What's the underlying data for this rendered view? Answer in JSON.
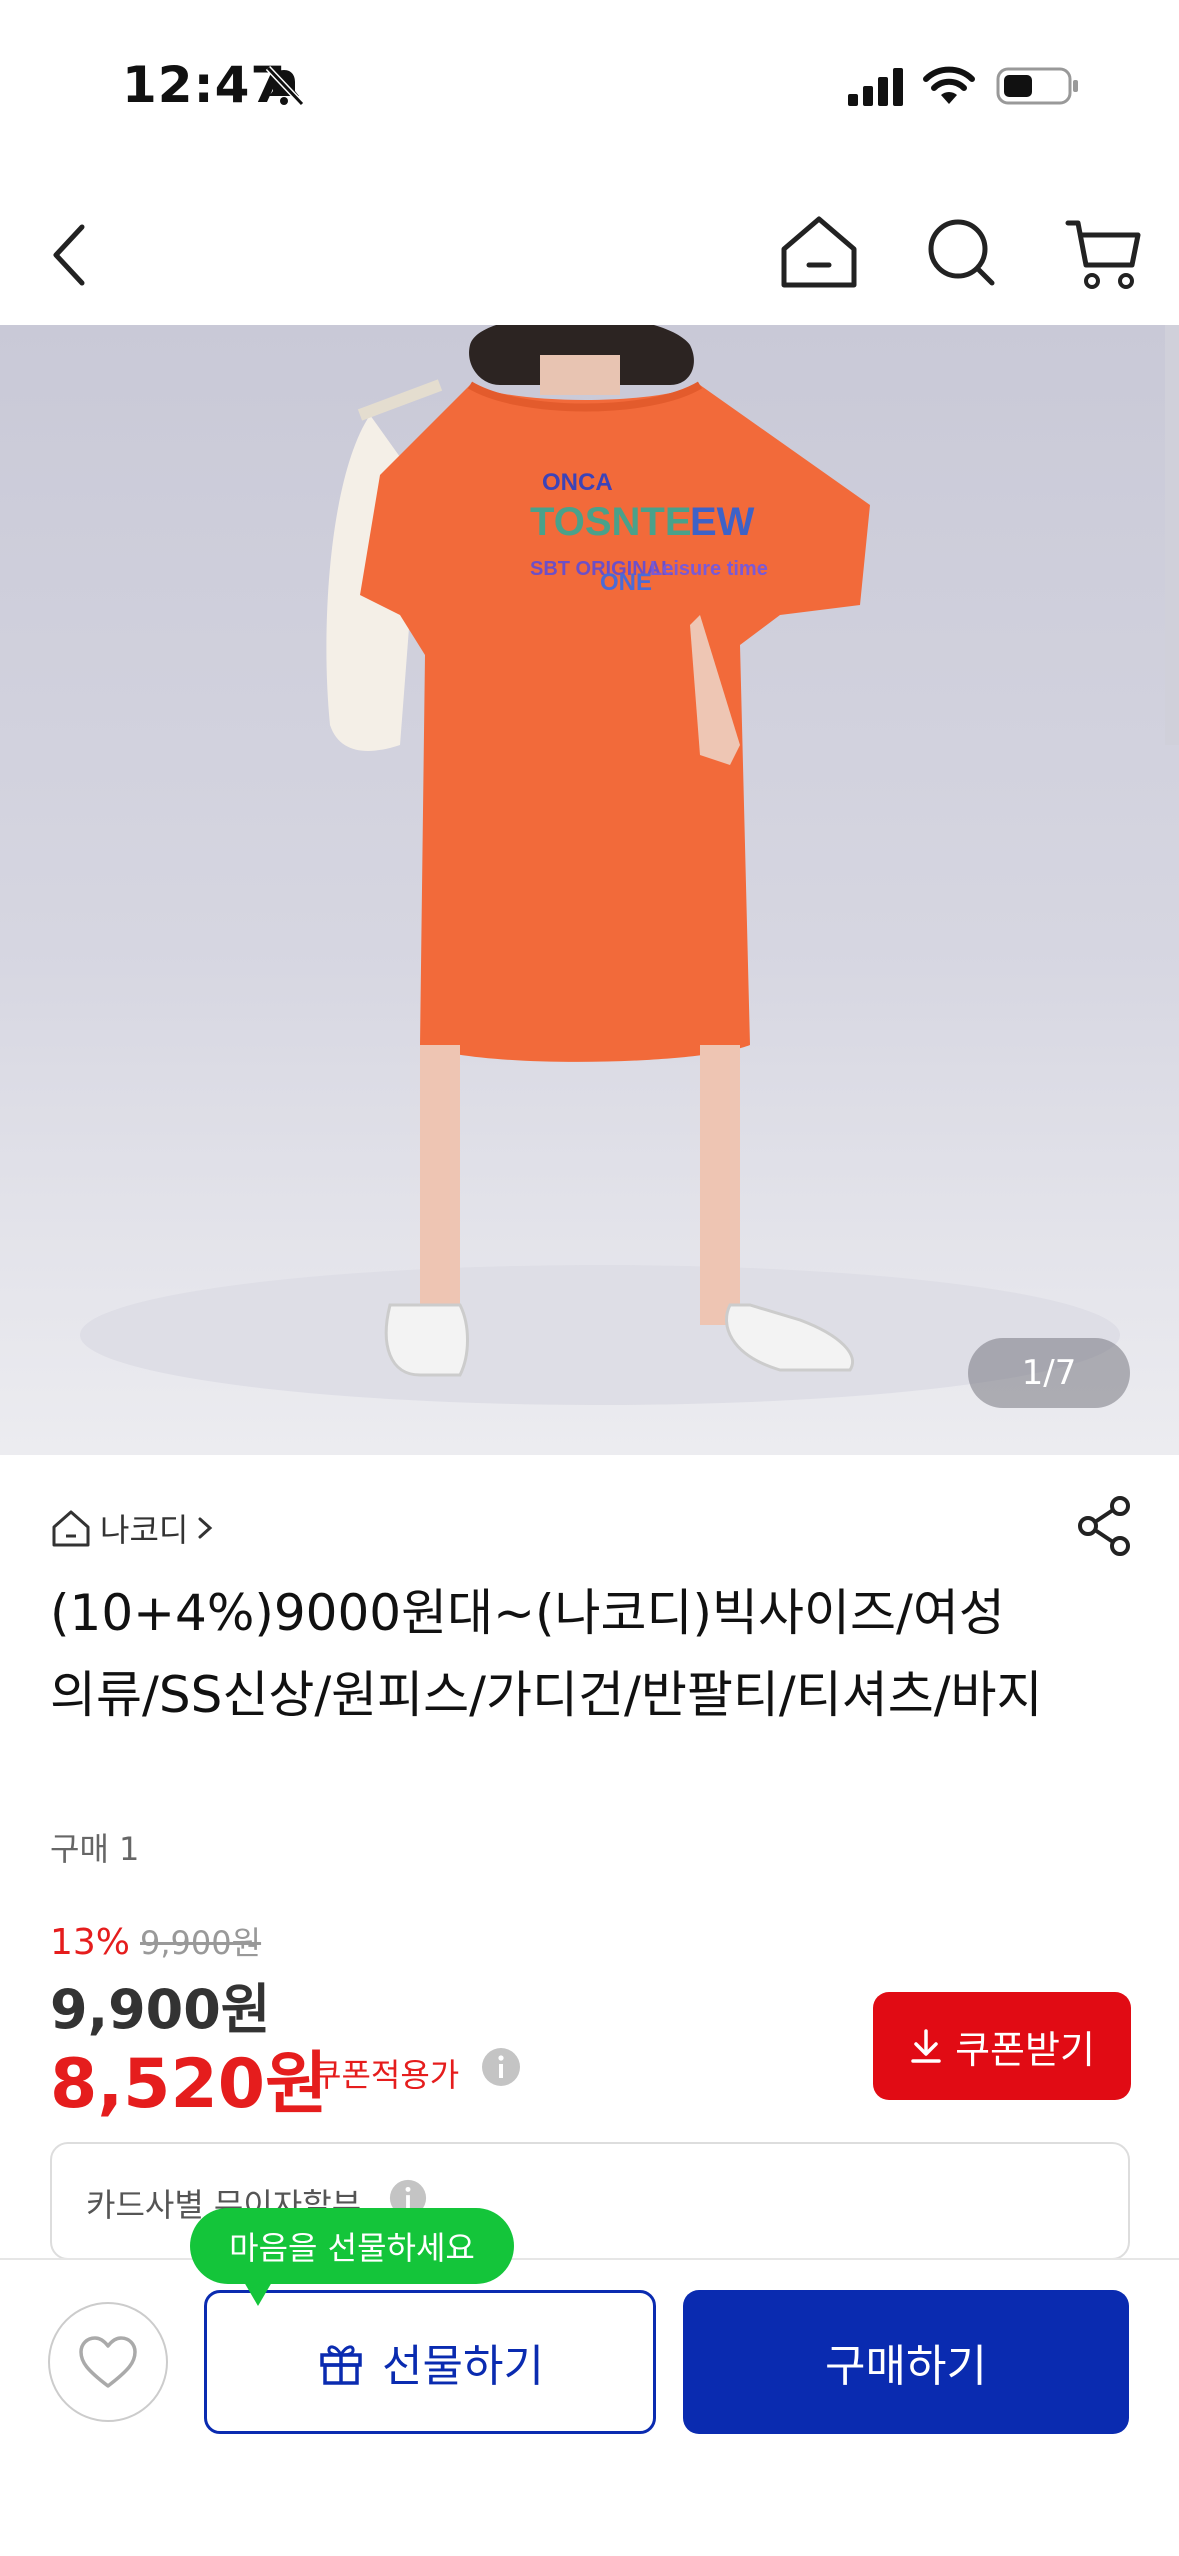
{
  "status_bar": {
    "time": "12:47"
  },
  "product": {
    "image_counter": "1/7",
    "seller_name": "나코디",
    "title": "(10+4%)9000원대~(나코디)빅사이즈/여성의류/SS신상/원피스/가디건/반팔티/티셔츠/바지",
    "purchase_count": "구매 1",
    "discount_rate": "13%",
    "original_price": "9,900원",
    "sale_price": "9,900원",
    "coupon_price": "8,520원",
    "coupon_price_label": "쿠폰적용가",
    "coupon_button_label": "쿠폰받기",
    "card_installment_text": "카드사별 무이자할부"
  },
  "bottom_bar": {
    "gift_tooltip": "마음을 선물하세요",
    "gift_button_label": "선물하기",
    "buy_button_label": "구매하기"
  },
  "colors": {
    "accent_red": "#e10b14",
    "accent_blue": "#0a2bb0",
    "tooltip_green": "#14c53a",
    "dress_orange": "#f26a3a"
  },
  "icons": [
    "bell-off-icon",
    "signal-icon",
    "wifi-icon",
    "battery-icon",
    "back-icon",
    "home-icon",
    "search-icon",
    "cart-icon",
    "shop-icon",
    "chevron-right-icon",
    "share-icon",
    "info-icon",
    "download-icon",
    "heart-icon",
    "gift-icon"
  ]
}
